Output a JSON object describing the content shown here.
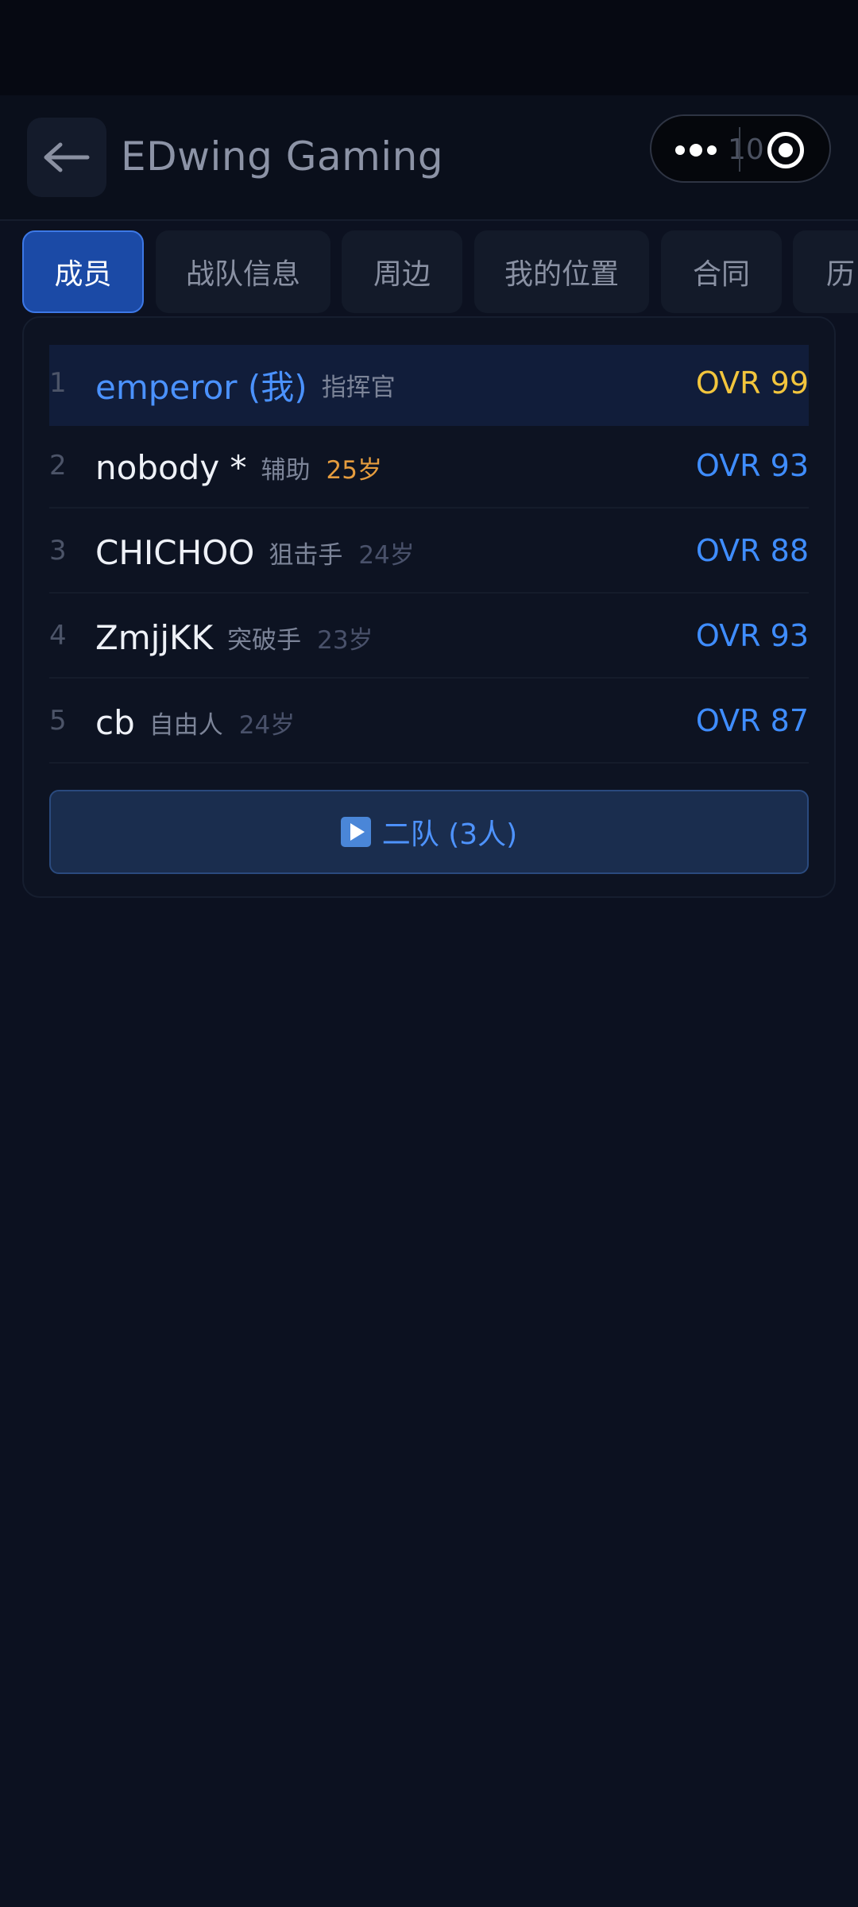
{
  "header": {
    "title": "EDwing Gaming",
    "back_icon": "arrow-left-icon",
    "capsule": {
      "more_icon": "more-dots-icon",
      "ghost_text": "10",
      "close_icon": "target-close-icon"
    }
  },
  "tabs": [
    {
      "label": "成员",
      "active": true
    },
    {
      "label": "战队信息",
      "active": false
    },
    {
      "label": "周边",
      "active": false
    },
    {
      "label": "我的位置",
      "active": false
    },
    {
      "label": "合同",
      "active": false
    },
    {
      "label": "历",
      "active": false
    }
  ],
  "members": [
    {
      "rank": "1",
      "name": "emperor (我)",
      "role": "指挥官",
      "age": "",
      "ovr": "OVR 99",
      "is_me": true
    },
    {
      "rank": "2",
      "name": "nobody *",
      "role": "辅助",
      "age": "25岁",
      "ovr": "OVR 93",
      "is_me": false
    },
    {
      "rank": "3",
      "name": "CHICHOO",
      "role": "狙击手",
      "age": "24岁",
      "ovr": "OVR 88",
      "is_me": false
    },
    {
      "rank": "4",
      "name": "ZmjjKK",
      "role": "突破手",
      "age": "23岁",
      "ovr": "OVR 93",
      "is_me": false
    },
    {
      "rank": "5",
      "name": "cb",
      "role": "自由人",
      "age": "24岁",
      "ovr": "OVR 87",
      "is_me": false
    }
  ],
  "second_team": {
    "icon": "play-icon",
    "label": "二队 (3人)"
  },
  "colors": {
    "background": "#0c1120",
    "accent_blue": "#3f8dff",
    "highlight_gold": "#f2c53d",
    "age_orange": "#e59c3e",
    "active_tab": "#1b4aa6"
  }
}
